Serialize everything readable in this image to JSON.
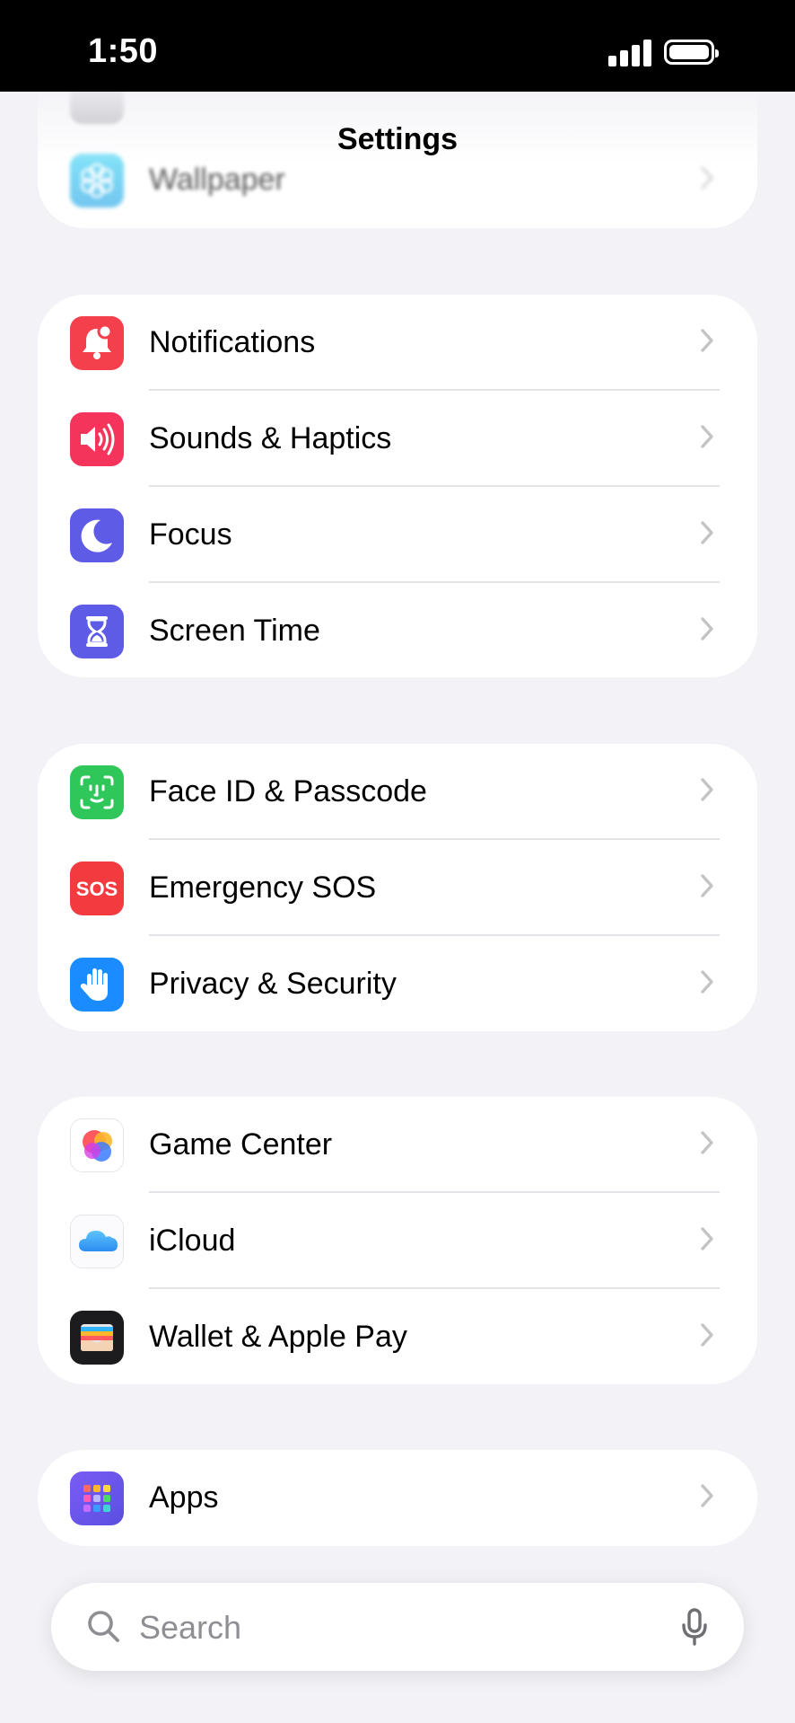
{
  "status_bar": {
    "time": "1:50"
  },
  "nav": {
    "title": "Settings"
  },
  "groups": [
    {
      "items": [
        {
          "label": "Wallpaper",
          "icon": "wallpaper-icon",
          "color": "#37c6ef"
        }
      ]
    },
    {
      "items": [
        {
          "label": "Notifications",
          "icon": "notifications-bell-icon",
          "color": "#f43f4c"
        },
        {
          "label": "Sounds & Haptics",
          "icon": "speaker-icon",
          "color": "#f5345c"
        },
        {
          "label": "Focus",
          "icon": "moon-icon",
          "color": "#5e5ce6"
        },
        {
          "label": "Screen Time",
          "icon": "hourglass-icon",
          "color": "#5e5ce6"
        }
      ]
    },
    {
      "items": [
        {
          "label": "Face ID & Passcode",
          "icon": "face-id-icon",
          "color": "#30c75a"
        },
        {
          "label": "Emergency SOS",
          "icon": "sos-icon",
          "icon_text": "SOS",
          "color": "#f23a3f"
        },
        {
          "label": "Privacy & Security",
          "icon": "hand-icon",
          "color": "#1a8cff"
        }
      ]
    },
    {
      "items": [
        {
          "label": "Game Center",
          "icon": "game-center-icon",
          "color": "#ffffff"
        },
        {
          "label": "iCloud",
          "icon": "icloud-icon",
          "color": "#ffffff"
        },
        {
          "label": "Wallet & Apple Pay",
          "icon": "wallet-icon",
          "color": "#1c1c1e"
        }
      ]
    },
    {
      "items": [
        {
          "label": "Apps",
          "icon": "apps-grid-icon",
          "color": "#6e5cf0"
        }
      ]
    }
  ],
  "search": {
    "placeholder": "Search"
  }
}
